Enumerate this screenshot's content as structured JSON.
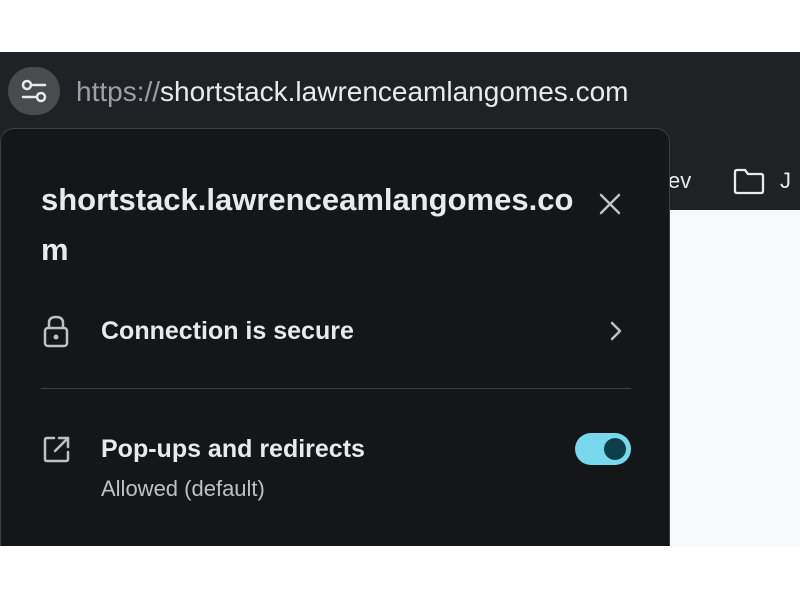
{
  "omnibox": {
    "url_scheme": "https://",
    "url_host": "shortstack.lawrenceamlangomes.com",
    "site_settings_icon": "tune-icon"
  },
  "bookmarks": {
    "item_partial": "ev",
    "folder_partial": "J",
    "folder_icon": "folder-icon"
  },
  "popup": {
    "title": "shortstack.lawrenceamlangomes.com",
    "close_icon": "close-icon",
    "connection": {
      "label": "Connection is secure",
      "icon": "lock-icon",
      "chevron_icon": "chevron-right-icon"
    },
    "popups": {
      "label": "Pop-ups and redirects",
      "sublabel": "Allowed (default)",
      "icon": "open-in-new-icon",
      "enabled": true
    }
  },
  "colors": {
    "toolbar_bg": "#202124",
    "popup_bg": "#151618",
    "toggle_track": "#78d9ec",
    "toggle_knob": "#0d3f4a",
    "text_primary": "#e8eaed",
    "text_secondary": "#bdc1c6"
  }
}
